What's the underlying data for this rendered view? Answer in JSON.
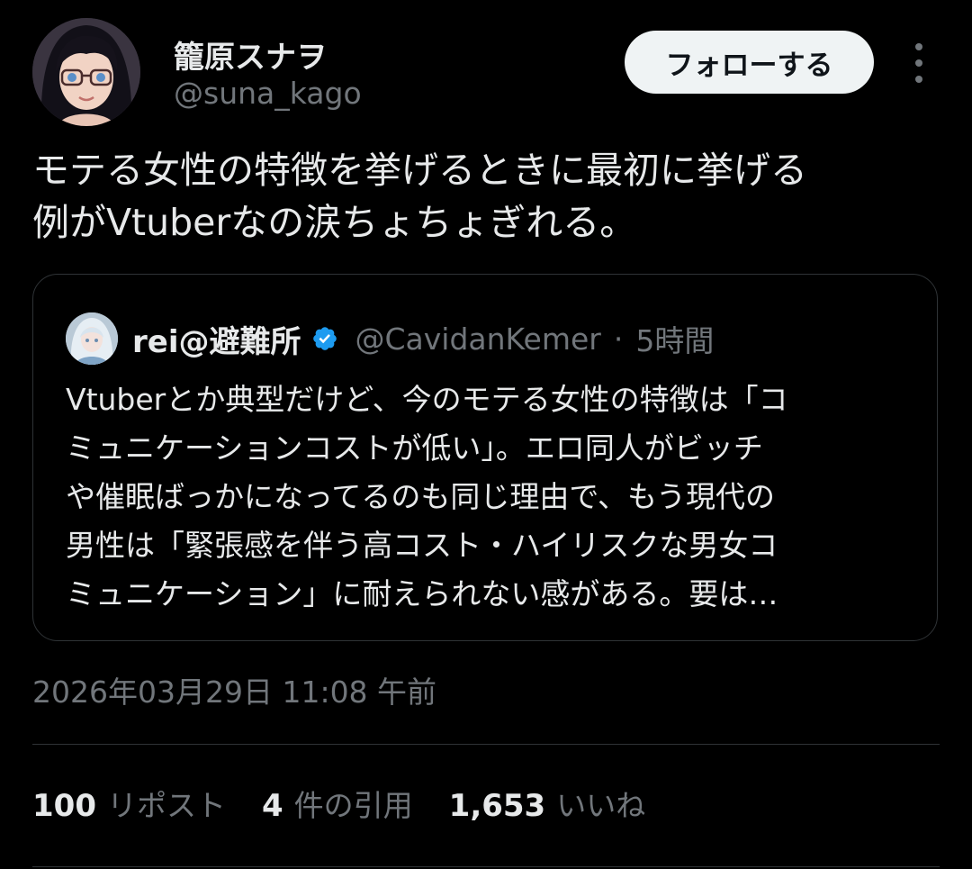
{
  "author": {
    "name": "籠原スナヲ",
    "handle": "@suna_kago",
    "avatar": "anime-girl-with-glasses"
  },
  "follow_label": "フォローする",
  "more_icon": "more-vertical-icon",
  "tweet": {
    "text": "モテる女性の特徴を挙げるときに最初に挙げる\n例がVtuberなの涙ちょちょぎれる。"
  },
  "quote": {
    "name": "rei@避難所",
    "verified": true,
    "handle": "@CavidanKemer",
    "separator": "·",
    "time": "5時間",
    "text": "Vtuberとか典型だけど、今のモテる女性の特徴は「コ\nミュニケーションコストが低い」。エロ同人がビッチ\nや催眠ばっかになってるのも同じ理由で、もう現代の\n男性は「緊張感を伴う高コスト・ハイリスクな男女コ\nミュニケーション」に耐えられない感がある。要は…"
  },
  "timestamp": "2026年03月29日 11:08 午前",
  "stats": {
    "reposts": {
      "count": "100",
      "label": "リポスト"
    },
    "quotes": {
      "count": "4",
      "label": "件の引用"
    },
    "likes": {
      "count": "1,653",
      "label": "いいね"
    }
  },
  "colors": {
    "background": "#000000",
    "primary_text": "#e7e9ea",
    "secondary_text": "#71767b",
    "border": "#2f3336",
    "verified": "#1d9bf0",
    "follow_button_bg": "#eff3f4"
  }
}
